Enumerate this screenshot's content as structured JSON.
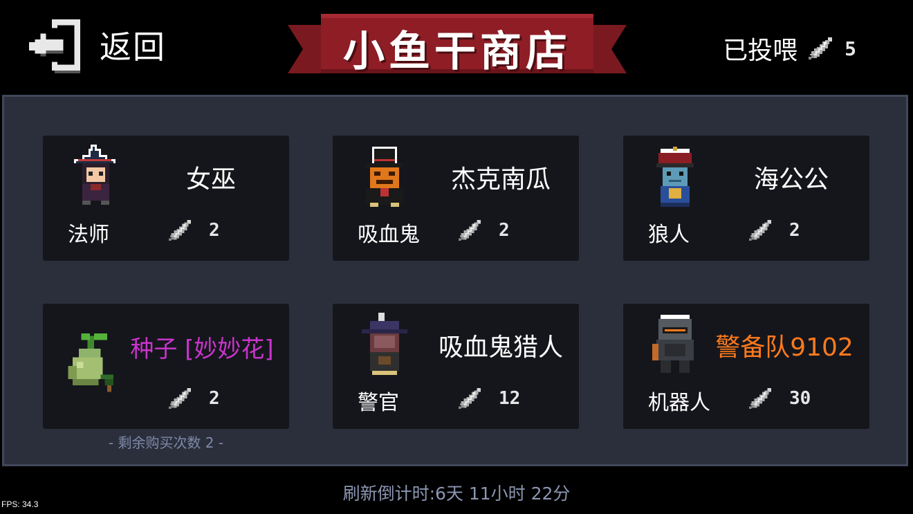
{
  "header": {
    "back_label": "返回",
    "title": "小鱼干商店",
    "fed_label": "已投喂",
    "fed_count": "5",
    "banner_color": "#8f1d26"
  },
  "items": [
    {
      "name": "女巫",
      "type": "法师",
      "price": "2",
      "icon": "witch-portrait"
    },
    {
      "name": "杰克南瓜",
      "type": "吸血鬼",
      "price": "2",
      "icon": "jack-pumpkin-portrait"
    },
    {
      "name": "海公公",
      "type": "狼人",
      "price": "2",
      "icon": "eunuch-portrait"
    },
    {
      "name": "种子 [妙妙花]",
      "type": "",
      "price": "2",
      "icon": "seed-icon",
      "name_color": "#c934cc"
    },
    {
      "name": "吸血鬼猎人",
      "type": "警官",
      "price": "12",
      "icon": "vampire-hunter-portrait"
    },
    {
      "name": "警备队9102",
      "type": "机器人",
      "price": "30",
      "icon": "robot-guard-portrait",
      "name_color": "#ff7a1c"
    }
  ],
  "remaining_purchases": "- 剩余购买次数 2 -",
  "refresh_countdown": "刷新倒计时:6天 11小时 22分",
  "fps": "FPS: 34.3",
  "currency_icon": "dried-fish-icon"
}
